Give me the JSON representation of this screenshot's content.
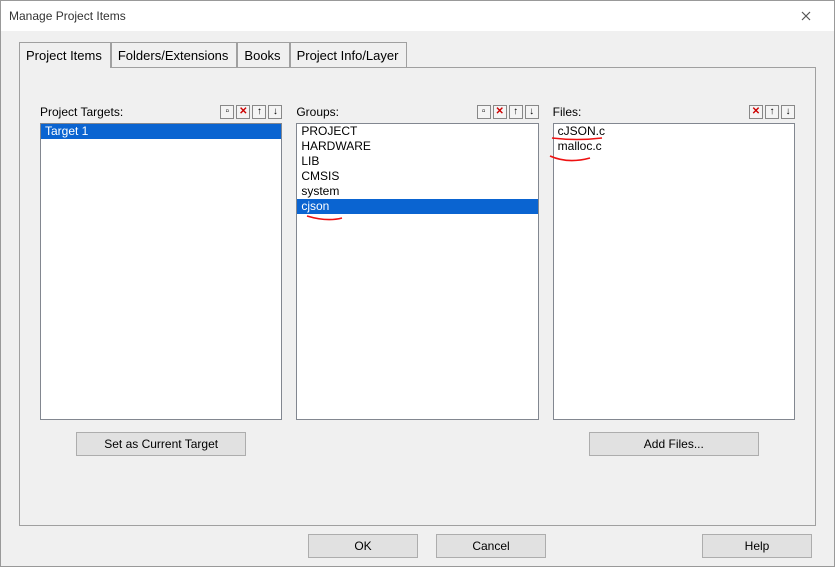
{
  "window": {
    "title": "Manage Project Items"
  },
  "tabs": [
    {
      "label": "Project Items",
      "active": true
    },
    {
      "label": "Folders/Extensions",
      "active": false
    },
    {
      "label": "Books",
      "active": false
    },
    {
      "label": "Project Info/Layer",
      "active": false
    }
  ],
  "targets": {
    "label": "Project Targets:",
    "items": [
      {
        "name": "Target 1",
        "selected": true
      }
    ],
    "button": "Set as Current Target"
  },
  "groups": {
    "label": "Groups:",
    "items": [
      {
        "name": "PROJECT"
      },
      {
        "name": "HARDWARE"
      },
      {
        "name": "LIB"
      },
      {
        "name": "CMSIS"
      },
      {
        "name": "system"
      },
      {
        "name": "cjson",
        "selected": true
      }
    ]
  },
  "files": {
    "label": "Files:",
    "items": [
      {
        "name": "cJSON.c"
      },
      {
        "name": "malloc.c"
      }
    ],
    "button": "Add Files..."
  },
  "footer": {
    "ok": "OK",
    "cancel": "Cancel",
    "help": "Help"
  },
  "icons": {
    "new": "▫",
    "del": "✕",
    "up": "↑",
    "down": "↓"
  }
}
